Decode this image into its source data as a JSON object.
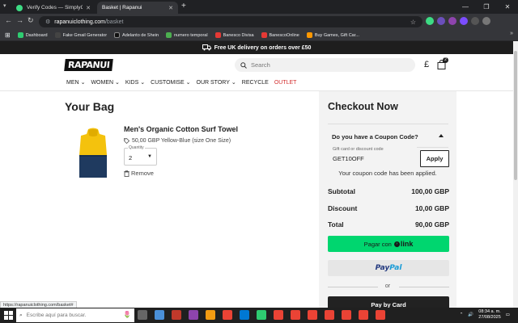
{
  "browser": {
    "tabs": [
      {
        "label": "Verify Codes — SimplyCodes",
        "active": false
      },
      {
        "label": "Basket | Rapanui",
        "active": true
      }
    ],
    "url_domain": "rapanuiclothing.com",
    "url_path": "/basket",
    "bookmarks": [
      {
        "label": "Dashboard",
        "color": "#2ecc71"
      },
      {
        "label": "Fake Gmail Generator",
        "color": "#444444"
      },
      {
        "label": "Adelanto de Shein",
        "color": "#111111"
      },
      {
        "label": "numero temporal",
        "color": "#4caf50"
      },
      {
        "label": "Banesco Divisa",
        "color": "#e53935"
      },
      {
        "label": "BanescoOnline",
        "color": "#e53935"
      },
      {
        "label": "Buy Games, Gift Car...",
        "color": "#ff9800"
      }
    ],
    "status_url": "https://rapanuiclothing.com/basket#"
  },
  "site": {
    "promo": "Free UK delivery on orders over £50",
    "logo": "RAPANUI",
    "search_placeholder": "Search",
    "currency_symbol": "£",
    "cart_count": "2",
    "nav": [
      {
        "label": "MEN",
        "dropdown": true
      },
      {
        "label": "WOMEN",
        "dropdown": true
      },
      {
        "label": "KIDS",
        "dropdown": true
      },
      {
        "label": "CUSTOMISE",
        "dropdown": true
      },
      {
        "label": "OUR STORY",
        "dropdown": true
      },
      {
        "label": "RECYCLE",
        "dropdown": false
      },
      {
        "label": "OUTLET",
        "dropdown": false
      }
    ]
  },
  "bag": {
    "title": "Your Bag",
    "product": {
      "name": "Men's Organic Cotton Surf Towel",
      "meta": "50,00 GBP Yellow-Blue (size One Size)",
      "quantity_label": "Quantity",
      "quantity": "2",
      "remove_label": "Remove"
    }
  },
  "checkout": {
    "title": "Checkout Now",
    "coupon_question": "Do you have a Coupon Code?",
    "code_label": "Gift card or discount code",
    "code_value": "GET10OFF",
    "apply_label": "Apply",
    "coupon_message": "Your coupon code has been applied.",
    "subtotal_label": "Subtotal",
    "subtotal_value": "100,00 GBP",
    "discount_label": "Discount",
    "discount_value": "10,00 GBP",
    "total_label": "Total",
    "total_value": "90,00 GBP",
    "link_prefix": "Pagar con",
    "link_brand": "link",
    "paypal_part1": "Pay",
    "paypal_part2": "Pal",
    "or_label": "or",
    "pay_by_card": "Pay by Card"
  },
  "taskbar": {
    "search_placeholder": "Escribe aquí para buscar.",
    "time": "08:34 a. m.",
    "date": "27/08/2025"
  },
  "colors": {
    "link_green": "#00d66f",
    "outlet_red": "#d32f2f",
    "promo_bar": "#1e1e1e"
  }
}
